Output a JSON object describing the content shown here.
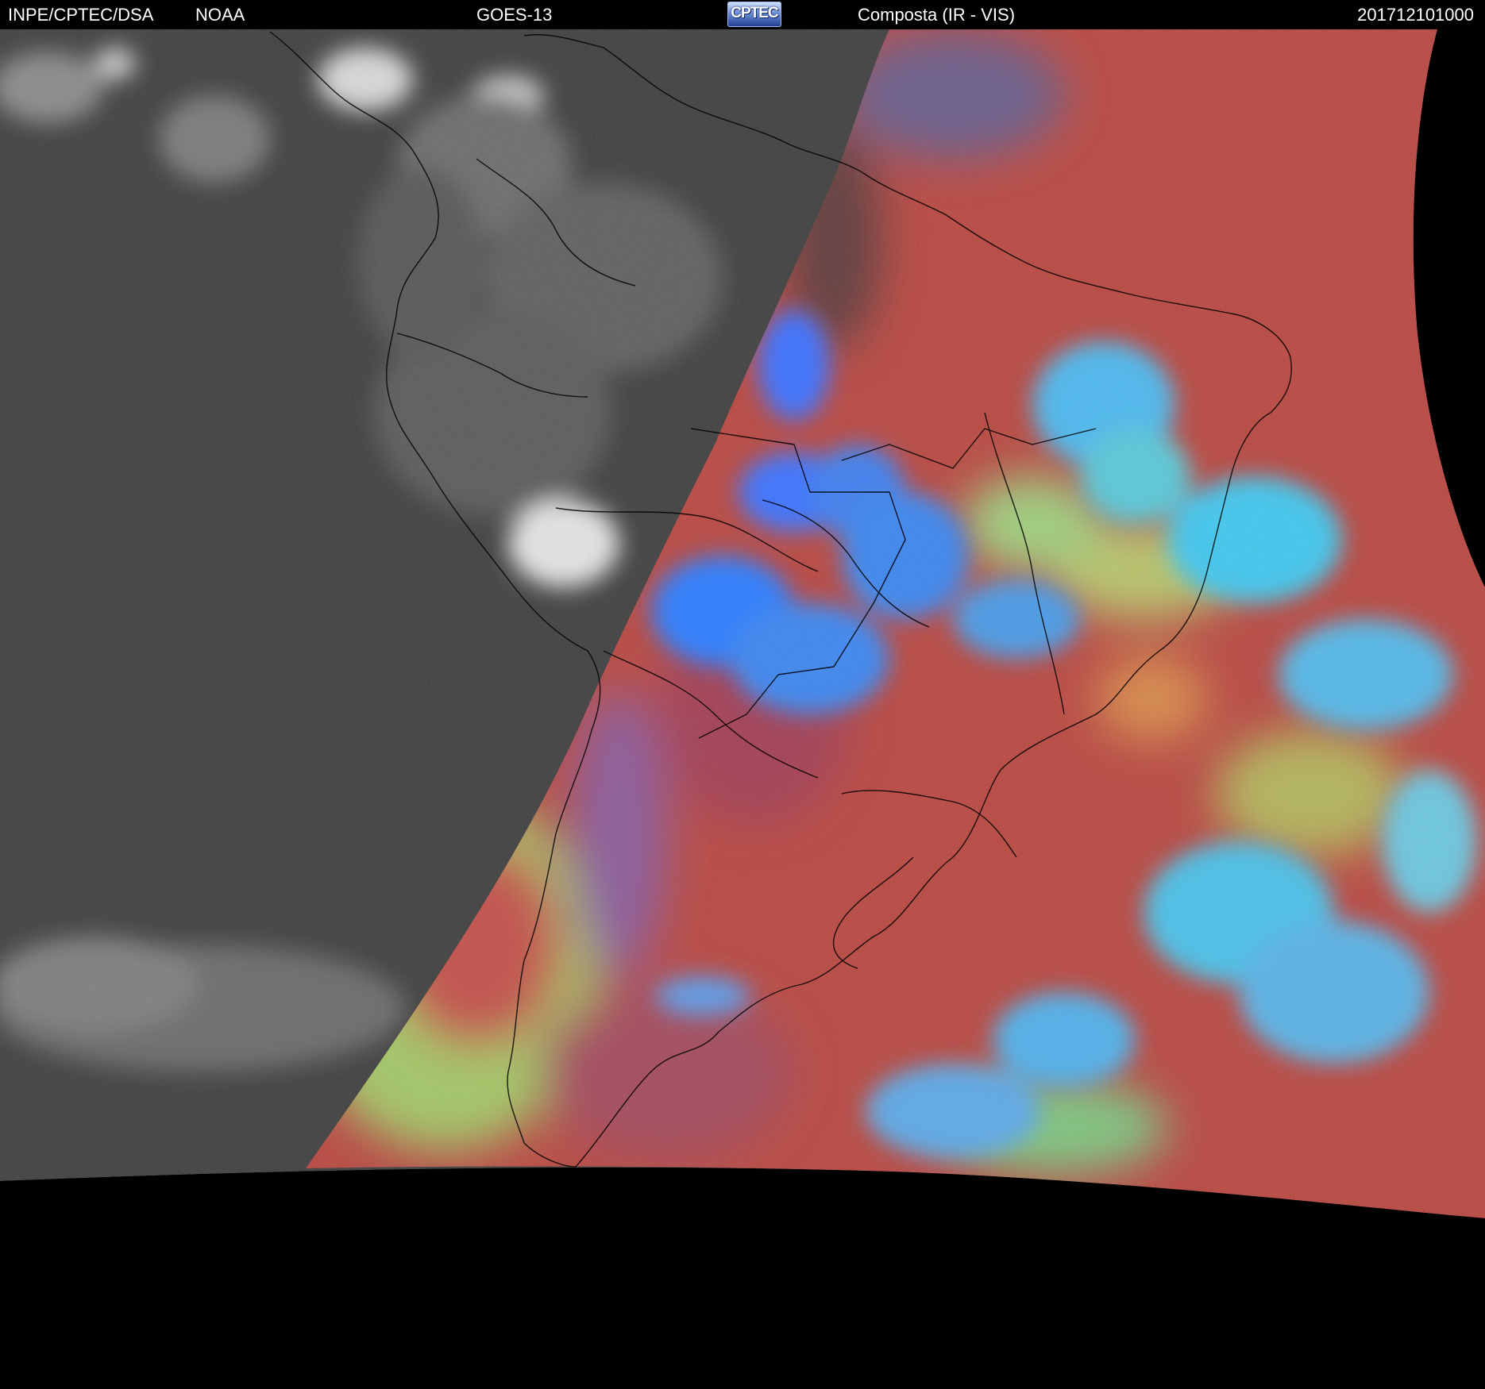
{
  "header": {
    "source": "INPE/CPTEC/DSA",
    "agency": "NOAA",
    "satellite": "GOES-13",
    "logo_text": "CPTEC",
    "product": "Composta (IR - VIS)",
    "timestamp": "201712101000"
  },
  "colors": {
    "ir_night": "#3e3e3e",
    "composite_red": "#b8463f",
    "cloud_blue": "#2e78ff",
    "cloud_cyan": "#3fc6ee",
    "low_cloud_green": "#9ad05a",
    "outline": "#000000",
    "space": "#000000"
  }
}
